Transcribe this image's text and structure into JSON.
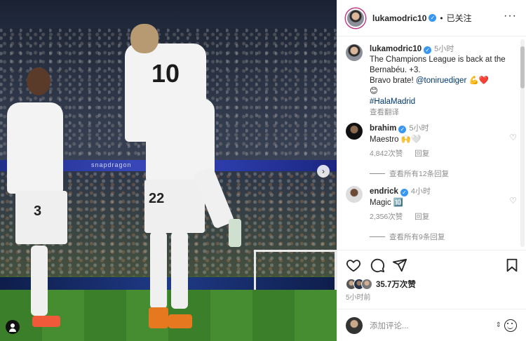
{
  "post": {
    "photo_alt": "Players celebrating on the pitch",
    "jersey_numbers": {
      "main": "10",
      "front": "22",
      "left": "3"
    },
    "banner_text": "snapdragon",
    "next_label": "›"
  },
  "header": {
    "username": "lukamodric10",
    "separator": "•",
    "follow_label": "已关注",
    "more_label": "···"
  },
  "caption": {
    "username": "lukamodric10",
    "time": "5小时",
    "line1": "The Champions League is back at the Bernabéu. +3.",
    "line2_prefix": "Bravo brate!",
    "mention": "@toniruediger",
    "emojis": "💪❤️",
    "emoji2": "😊",
    "hashtag": "#HalaMadrid",
    "translate": "查看翻译"
  },
  "comments": [
    {
      "username": "brahim",
      "time": "5小时",
      "text": "Maestro 🙌🤍",
      "likes": "4,842次赞",
      "reply_label": "回复",
      "view_replies": "查看所有12条回复"
    },
    {
      "username": "endrick",
      "time": "4小时",
      "text": "Magic 🔟",
      "likes": "2,356次赞",
      "reply_label": "回复",
      "view_replies": "查看所有9条回复"
    }
  ],
  "actions": {
    "likes_count": "35.7万次赞",
    "post_time": "5小时前"
  },
  "add_comment": {
    "placeholder": "添加评论...",
    "sticker": "⇕"
  },
  "colors": {
    "verified": "#3897f0",
    "link": "#00376b",
    "muted": "#8e8e8e",
    "heart": "#ed4956"
  }
}
